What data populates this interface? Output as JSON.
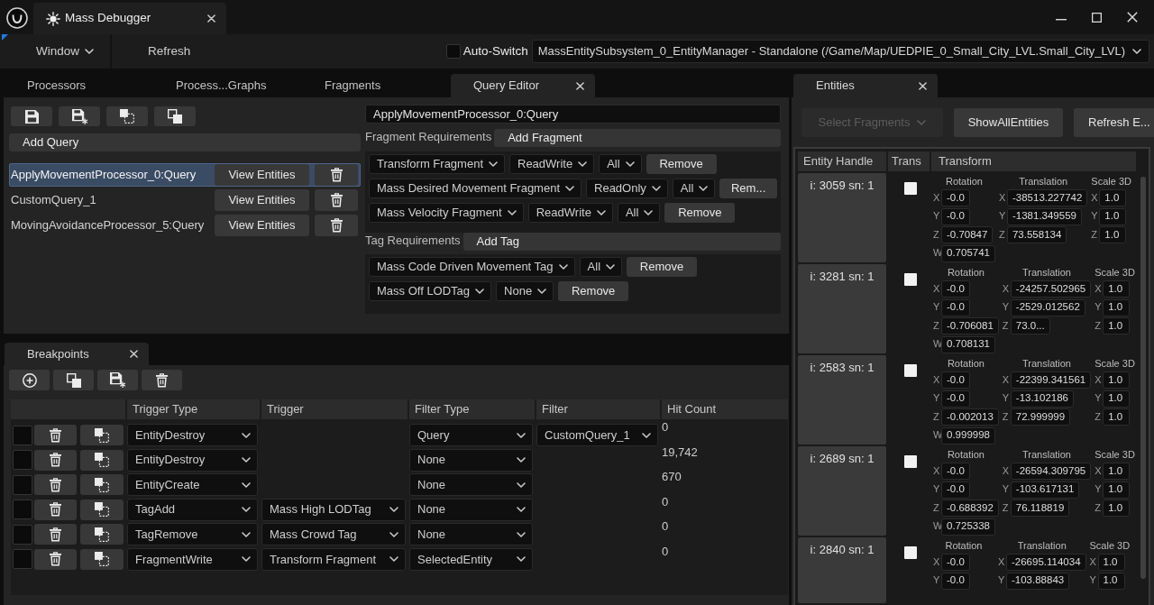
{
  "window": {
    "title": "Mass Debugger"
  },
  "toolbar": {
    "items": [
      {
        "label": "Window",
        "kind": "menu"
      },
      {
        "label": "Refresh",
        "kind": "button"
      }
    ],
    "auto_switch": {
      "label": "Auto-Switch",
      "checked": false
    },
    "environment": "MassEntitySubsystem_0_EntityManager - Standalone (/Game/Map/UEDPIE_0_Small_City_LVL.Small_City_LVL)"
  },
  "main_tabs": [
    {
      "label": "Processors",
      "selected": false
    },
    {
      "label": "Process...Graphs",
      "selected": false
    },
    {
      "label": "Fragments",
      "selected": false
    },
    {
      "label": "Query Editor",
      "selected": true
    }
  ],
  "query_list": {
    "add_button": "Add Query",
    "queries": [
      {
        "name": "ApplyMovementProcessor_0:Query",
        "selected": true,
        "action": "View Entities"
      },
      {
        "name": "CustomQuery_1",
        "selected": false,
        "action": "View Entities"
      },
      {
        "name": "MovingAvoidanceProcessor_5:Query",
        "selected": false,
        "action": "View Entities"
      }
    ]
  },
  "query_editor": {
    "name": "ApplyMovementProcessor_0:Query",
    "fragment_label": "Fragment Requirements",
    "add_fragment": "Add Fragment",
    "fragments": [
      {
        "name": "Transform Fragment",
        "access": "ReadWrite",
        "presence": "All",
        "remove": "Remove"
      },
      {
        "name": "Mass Desired Movement Fragment",
        "access": "ReadOnly",
        "presence": "All",
        "remove": "Rem..."
      },
      {
        "name": "Mass Velocity Fragment",
        "access": "ReadWrite",
        "presence": "All",
        "remove": "Remove"
      }
    ],
    "tag_label": "Tag Requirements",
    "add_tag": "Add Tag",
    "tags": [
      {
        "name": "Mass Code Driven Movement Tag",
        "presence": "All",
        "remove": "Remove"
      },
      {
        "name": "Mass Off LODTag",
        "presence": "None",
        "remove": "Remove"
      }
    ]
  },
  "breakpoints": {
    "tab": "Breakpoints",
    "columns": [
      "Trigger Type",
      "Trigger",
      "Filter Type",
      "Filter",
      "Hit Count"
    ],
    "rows": [
      {
        "checked": false,
        "trigger_type": "EntityDestroy",
        "filter_type": "Query",
        "filter": "CustomQuery_1",
        "hit_count": "0"
      },
      {
        "checked": false,
        "trigger_type": "EntityDestroy",
        "filter_type": "None",
        "hit_count": "19,742"
      },
      {
        "checked": false,
        "trigger_type": "EntityCreate",
        "filter_type": "None",
        "hit_count": "670"
      },
      {
        "checked": false,
        "trigger_type": "TagAdd",
        "trigger": "Mass High LODTag",
        "filter_type": "None",
        "hit_count": "0"
      },
      {
        "checked": false,
        "trigger_type": "TagRemove",
        "trigger": "Mass Crowd Tag",
        "filter_type": "None",
        "hit_count": "0"
      },
      {
        "checked": false,
        "trigger_type": "FragmentWrite",
        "trigger": "Transform Fragment",
        "filter_type": "SelectedEntity",
        "hit_count": "0"
      }
    ]
  },
  "entities": {
    "tab": "Entities",
    "fragment_picker": {
      "label": "Select Fragments",
      "disabled": true
    },
    "buttons": [
      "ShowAllEntities",
      "Refresh E..."
    ],
    "columns": [
      "Entity Handle",
      "Trans",
      "Transform"
    ],
    "rows": [
      {
        "handle": "i: 3059 sn: 1",
        "checked": false,
        "groups": [
          {
            "label": "Rotation",
            "fields": [
              {
                "axis": "X",
                "value": "-0.0"
              },
              {
                "axis": "Y",
                "value": "-0.0"
              },
              {
                "axis": "Z",
                "value": "-0.70847"
              },
              {
                "axis": "W",
                "value": "0.705741"
              }
            ]
          },
          {
            "label": "Translation",
            "fields": [
              {
                "axis": "X",
                "value": "-38513.227742"
              },
              {
                "axis": "Y",
                "value": "-1381.349559"
              },
              {
                "axis": "Z",
                "value": "73.558134"
              }
            ]
          },
          {
            "label": "Scale 3D",
            "fields": [
              {
                "axis": "X",
                "value": "1.0"
              },
              {
                "axis": "Y",
                "value": "1.0"
              },
              {
                "axis": "Z",
                "value": "1.0"
              }
            ]
          }
        ]
      },
      {
        "handle": "i: 3281 sn: 1",
        "checked": false,
        "groups": [
          {
            "label": "Rotation",
            "fields": [
              {
                "axis": "X",
                "value": "-0.0"
              },
              {
                "axis": "Y",
                "value": "-0.0"
              },
              {
                "axis": "Z",
                "value": "-0.706081"
              },
              {
                "axis": "W",
                "value": "0.708131"
              }
            ]
          },
          {
            "label": "Translation",
            "fields": [
              {
                "axis": "X",
                "value": "-24257.502965"
              },
              {
                "axis": "Y",
                "value": "-2529.012562"
              },
              {
                "axis": "Z",
                "value": "73.0..."
              }
            ]
          },
          {
            "label": "Scale 3D",
            "fields": [
              {
                "axis": "X",
                "value": "1.0"
              },
              {
                "axis": "Y",
                "value": "1.0"
              },
              {
                "axis": "Z",
                "value": "1.0"
              }
            ]
          }
        ]
      },
      {
        "handle": "i: 2583 sn: 1",
        "checked": false,
        "groups": [
          {
            "label": "Rotation",
            "fields": [
              {
                "axis": "X",
                "value": "-0.0"
              },
              {
                "axis": "Y",
                "value": "-0.0"
              },
              {
                "axis": "Z",
                "value": "-0.002013"
              },
              {
                "axis": "W",
                "value": "0.999998"
              }
            ]
          },
          {
            "label": "Translation",
            "fields": [
              {
                "axis": "X",
                "value": "-22399.341561"
              },
              {
                "axis": "Y",
                "value": "-13.102186"
              },
              {
                "axis": "Z",
                "value": "72.999999"
              }
            ]
          },
          {
            "label": "Scale 3D",
            "fields": [
              {
                "axis": "X",
                "value": "1.0"
              },
              {
                "axis": "Y",
                "value": "1.0"
              },
              {
                "axis": "Z",
                "value": "1.0"
              }
            ]
          }
        ]
      },
      {
        "handle": "i: 2689 sn: 1",
        "checked": false,
        "groups": [
          {
            "label": "Rotation",
            "fields": [
              {
                "axis": "X",
                "value": "-0.0"
              },
              {
                "axis": "Y",
                "value": "-0.0"
              },
              {
                "axis": "Z",
                "value": "-0.688392"
              },
              {
                "axis": "W",
                "value": "0.725338"
              }
            ]
          },
          {
            "label": "Translation",
            "fields": [
              {
                "axis": "X",
                "value": "-26594.309795"
              },
              {
                "axis": "Y",
                "value": "-103.617131"
              },
              {
                "axis": "Z",
                "value": "76.118819"
              }
            ]
          },
          {
            "label": "Scale 3D",
            "fields": [
              {
                "axis": "X",
                "value": "1.0"
              },
              {
                "axis": "Y",
                "value": "1.0"
              },
              {
                "axis": "Z",
                "value": "1.0"
              }
            ]
          }
        ]
      },
      {
        "handle": "i: 2840 sn: 1",
        "checked": false,
        "groups": [
          {
            "label": "Rotation",
            "fields": [
              {
                "axis": "X",
                "value": "-0.0"
              },
              {
                "axis": "Y",
                "value": "-0.0"
              }
            ]
          },
          {
            "label": "Translation",
            "fields": [
              {
                "axis": "X",
                "value": "-26695.114034"
              },
              {
                "axis": "Y",
                "value": "-103.88843"
              }
            ]
          },
          {
            "label": "Scale 3D",
            "fields": [
              {
                "axis": "X",
                "value": "1.0"
              },
              {
                "axis": "Y",
                "value": "1.0"
              }
            ]
          }
        ]
      }
    ]
  }
}
